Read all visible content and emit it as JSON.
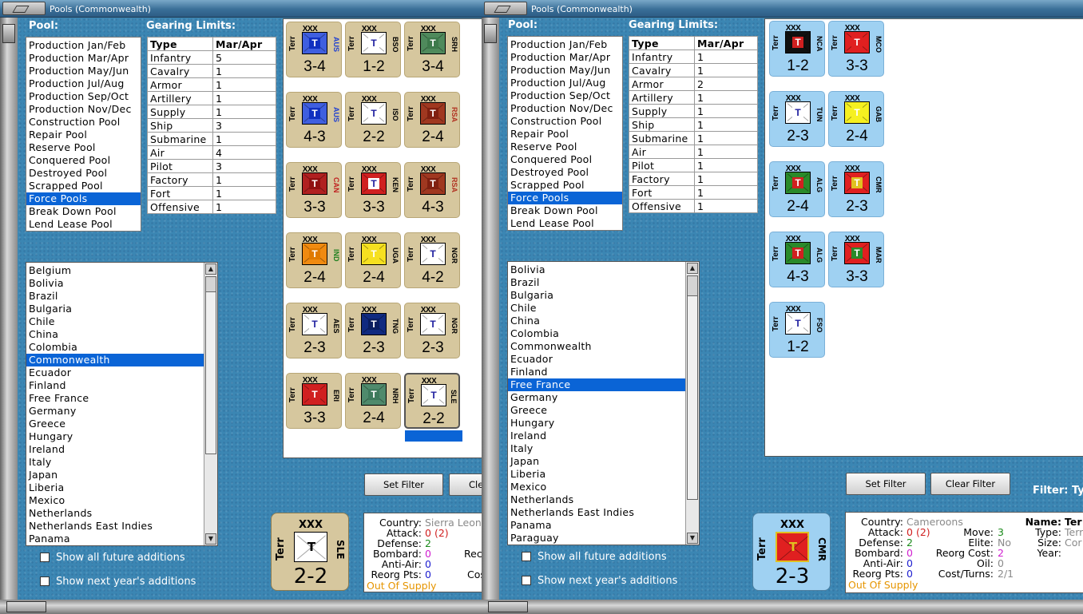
{
  "left": {
    "title": "Pools (Commonwealth)",
    "pool_label": "Pool:",
    "pools": [
      "Production Jan/Feb",
      "Production Mar/Apr",
      "Production May/Jun",
      "Production Jul/Aug",
      "Production Sep/Oct",
      "Production Nov/Dec",
      "Construction Pool",
      "Repair Pool",
      "Reserve Pool",
      "Conquered Pool",
      "Destroyed Pool",
      "Scrapped Pool",
      "Force Pools",
      "Break Down Pool",
      "Lend Lease Pool"
    ],
    "pool_selected": 12,
    "gearing_label": "Gearing Limits:",
    "gear_headers": [
      "Type",
      "Mar/Apr"
    ],
    "gear_rows": [
      [
        "Infantry",
        "5"
      ],
      [
        "Cavalry",
        "1"
      ],
      [
        "Armor",
        "1"
      ],
      [
        "Artillery",
        "1"
      ],
      [
        "Supply",
        "1"
      ],
      [
        "Ship",
        "3"
      ],
      [
        "Submarine",
        "1"
      ],
      [
        "Air",
        "4"
      ],
      [
        "Pilot",
        "3"
      ],
      [
        "Factory",
        "1"
      ],
      [
        "Fort",
        "1"
      ],
      [
        "Offensive",
        "1"
      ]
    ],
    "countries": [
      "Belgium",
      "Bolivia",
      "Brazil",
      "Bulgaria",
      "Chile",
      "China",
      "Colombia",
      "Commonwealth",
      "Ecuador",
      "Finland",
      "Free France",
      "Germany",
      "Greece",
      "Hungary",
      "Ireland",
      "Italy",
      "Japan",
      "Liberia",
      "Mexico",
      "Netherlands",
      "Netherlands East Indies",
      "Panama"
    ],
    "country_selected": 7,
    "show_future": "Show all future additions",
    "show_next": "Show next year's additions",
    "set_filter": "Set Filter",
    "clear_filter": "Cle",
    "counters": [
      {
        "side": "Terr",
        "code": "AUS",
        "val": "3-4",
        "flag": "#3f5fe0",
        "inner": "#1030c0",
        "code_color": "#2040d0"
      },
      {
        "side": "Terr",
        "code": "BSO",
        "val": "1-2",
        "flag": "#ffffff",
        "inner": "#ffffff",
        "code_color": "#000000"
      },
      {
        "side": "Terr",
        "code": "SRH",
        "val": "3-4",
        "flag": "#4f8a5c",
        "inner": "#3e7a4c",
        "code_color": "#000000"
      },
      {
        "side": "Terr",
        "code": "AUS",
        "val": "4-3",
        "flag": "#3f5fe0",
        "inner": "#1030c0",
        "code_color": "#2040d0"
      },
      {
        "side": "Terr",
        "code": "ISO",
        "val": "2-2",
        "flag": "#ffffff",
        "inner": "#ffffff",
        "code_color": "#000000"
      },
      {
        "side": "Terr",
        "code": "RSA",
        "val": "2-4",
        "flag": "#a03820",
        "inner": "#802010",
        "code_color": "#b03020"
      },
      {
        "side": "Terr",
        "code": "CAN",
        "val": "3-3",
        "flag": "#b02020",
        "inner": "#901010",
        "code_color": "#c02020"
      },
      {
        "side": "Terr",
        "code": "KEN",
        "val": "3-3",
        "flag": "#d02020",
        "inner": "#ffffff",
        "code_color": "#000000"
      },
      {
        "side": "Terr",
        "code": "RSA",
        "val": "4-3",
        "flag": "#a03820",
        "inner": "#802010",
        "code_color": "#b03020"
      },
      {
        "side": "Terr",
        "code": "IND",
        "val": "2-4",
        "flag": "#f08a10",
        "inner": "#e07a00",
        "code_color": "#208020"
      },
      {
        "side": "Terr",
        "code": "UGA",
        "val": "2-4",
        "flag": "#f6e020",
        "inner": "#f6e020",
        "code_color": "#000000"
      },
      {
        "side": "Terr",
        "code": "NGR",
        "val": "4-2",
        "flag": "#ffffff",
        "inner": "#ffffff",
        "code_color": "#000000"
      },
      {
        "side": "Terr",
        "code": "AES",
        "val": "2-3",
        "flag": "#ffffff",
        "inner": "#ffffff",
        "code_color": "#000000"
      },
      {
        "side": "Terr",
        "code": "TNG",
        "val": "2-3",
        "flag": "#102a80",
        "inner": "#0a1e60",
        "code_color": "#000000"
      },
      {
        "side": "Terr",
        "code": "NGR",
        "val": "2-3",
        "flag": "#ffffff",
        "inner": "#ffffff",
        "code_color": "#000000"
      },
      {
        "side": "Terr",
        "code": "ERI",
        "val": "3-3",
        "flag": "#d02020",
        "inner": "#d02020",
        "code_color": "#000000"
      },
      {
        "side": "Terr",
        "code": "NRH",
        "val": "2-4",
        "flag": "#4f8a6c",
        "inner": "#3e7a5c",
        "code_color": "#000000"
      },
      {
        "side": "Terr",
        "code": "SLE",
        "val": "2-2",
        "flag": "#ffffff",
        "inner": "#ffffff",
        "code_color": "#000000"
      }
    ],
    "selected_counter": {
      "xxx": "XXX",
      "side": "Terr",
      "code": "SLE",
      "val": "2-2"
    },
    "info": {
      "country_k": "Country:",
      "country_v": "Sierra Leon",
      "attack_k": "Attack:",
      "attack_v": "0",
      "attack_x": "(2)",
      "defense_k": "Defense:",
      "defense_v": "2",
      "bombard_k": "Bombard:",
      "bombard_v": "0",
      "antiair_k": "Anti-Air:",
      "antiair_v": "0",
      "reorg_k": "Reorg Pts:",
      "reorg_v": "0",
      "supply": "Out Of Supply",
      "c2a": "Rec",
      "c2b": "Cos"
    }
  },
  "right": {
    "title": "Pools (Commonwealth)",
    "pool_label": "Pool:",
    "pools": [
      "Production Jan/Feb",
      "Production Mar/Apr",
      "Production May/Jun",
      "Production Jul/Aug",
      "Production Sep/Oct",
      "Production Nov/Dec",
      "Construction Pool",
      "Repair Pool",
      "Reserve Pool",
      "Conquered Pool",
      "Destroyed Pool",
      "Scrapped Pool",
      "Force Pools",
      "Break Down Pool",
      "Lend Lease Pool"
    ],
    "pool_selected": 12,
    "gearing_label": "Gearing Limits:",
    "gear_headers": [
      "Type",
      "Mar/Apr"
    ],
    "gear_rows": [
      [
        "Infantry",
        "1"
      ],
      [
        "Cavalry",
        "1"
      ],
      [
        "Armor",
        "2"
      ],
      [
        "Artillery",
        "1"
      ],
      [
        "Supply",
        "1"
      ],
      [
        "Ship",
        "1"
      ],
      [
        "Submarine",
        "1"
      ],
      [
        "Air",
        "1"
      ],
      [
        "Pilot",
        "1"
      ],
      [
        "Factory",
        "1"
      ],
      [
        "Fort",
        "1"
      ],
      [
        "Offensive",
        "1"
      ]
    ],
    "countries": [
      "Bolivia",
      "Brazil",
      "Bulgaria",
      "Chile",
      "China",
      "Colombia",
      "Commonwealth",
      "Ecuador",
      "Finland",
      "Free France",
      "Germany",
      "Greece",
      "Hungary",
      "Ireland",
      "Italy",
      "Japan",
      "Liberia",
      "Mexico",
      "Netherlands",
      "Netherlands East Indies",
      "Panama",
      "Paraguay"
    ],
    "country_selected": 9,
    "show_future": "Show all future additions",
    "show_next": "Show next year's additions",
    "set_filter": "Set Filter",
    "clear_filter": "Clear Filter",
    "filter_label": "Filter:",
    "filter_value": "Ty",
    "counters": [
      {
        "side": "Terr",
        "code": "NCA",
        "val": "1-2",
        "flag": "#101010",
        "inner": "#d02020",
        "code_color": "#000000"
      },
      {
        "side": "Terr",
        "code": "MCO",
        "val": "3-3",
        "flag": "#e02020",
        "inner": "#e02020",
        "code_color": "#000000"
      },
      {
        "side": "Terr",
        "code": "TUN",
        "val": "2-3",
        "flag": "#ffffff",
        "inner": "#ffffff",
        "code_color": "#000000"
      },
      {
        "side": "Terr",
        "code": "GAB",
        "val": "2-4",
        "flag": "#f6f020",
        "inner": "#f6f020",
        "code_color": "#000000"
      },
      {
        "side": "Terr",
        "code": "ALG",
        "val": "2-4",
        "flag": "#2a8a2a",
        "inner": "#d02020",
        "code_color": "#000000"
      },
      {
        "side": "Terr",
        "code": "CMR",
        "val": "2-3",
        "flag": "#e02020",
        "inner": "#e0c020",
        "code_color": "#000000"
      },
      {
        "side": "Terr",
        "code": "ALG",
        "val": "4-3",
        "flag": "#2a8a2a",
        "inner": "#d02020",
        "code_color": "#000000"
      },
      {
        "side": "Terr",
        "code": "MAR",
        "val": "3-3",
        "flag": "#e02020",
        "inner": "#2a8a2a",
        "code_color": "#000000"
      },
      {
        "side": "Terr",
        "code": "FSO",
        "val": "1-2",
        "flag": "#ffffff",
        "inner": "#ffffff",
        "code_color": "#000000"
      }
    ],
    "selected_counter": {
      "xxx": "XXX",
      "side": "Terr",
      "code": "CMR",
      "val": "2-3"
    },
    "info": {
      "country_k": "Country:",
      "country_v": "Cameroons",
      "attack_k": "Attack:",
      "attack_v": "0",
      "attack_x": "(2)",
      "defense_k": "Defense:",
      "defense_v": "2",
      "bombard_k": "Bombard:",
      "bombard_v": "0",
      "antiair_k": "Anti-Air:",
      "antiair_v": "0",
      "reorg_k": "Reorg Pts:",
      "reorg_v": "0",
      "supply": "Out Of Supply",
      "move_k": "Move:",
      "move_v": "3",
      "elite_k": "Elite:",
      "elite_v": "No",
      "rcost_k": "Reorg Cost:",
      "rcost_v": "2",
      "oil_k": "Oil:",
      "oil_v": "0",
      "cturns_k": "Cost/Turns:",
      "cturns_v": "2/1",
      "name_k": "Name:",
      "name_v": "Ter",
      "type_k": "Type:",
      "type_v": "Terr",
      "size_k": "Size:",
      "size_v": "Cor",
      "year_k": "Year:"
    }
  },
  "colors": {
    "selection": "#0a64d6",
    "tan": "#d6c79e",
    "lightblue": "#9fd1f2",
    "supply": "#e69500"
  }
}
